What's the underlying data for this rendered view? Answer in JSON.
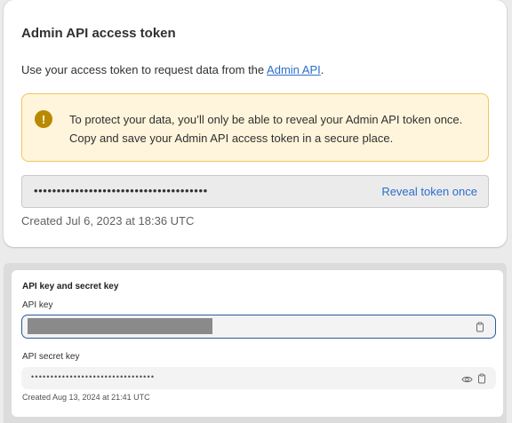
{
  "admin_token_card": {
    "title": "Admin API access token",
    "description_prefix": "Use your access token to request data from the ",
    "description_link": "Admin API",
    "description_suffix": ".",
    "warning": {
      "icon": "exclamation-icon",
      "message": "To protect your data, you’ll only be able to reveal your Admin API token once. Copy and save your Admin API access token in a secure place."
    },
    "token_mask": "••••••••••••••••••••••••••••••••••••••",
    "reveal_label": "Reveal token once",
    "created": "Created Jul 6, 2023 at 18:36 UTC"
  },
  "keys_card": {
    "title": "API key and secret key",
    "api_key_label": "API key",
    "api_secret_label": "API secret key",
    "secret_mask": "••••••••••••••••••••••••••••••••",
    "created": "Created Aug 13, 2024 at 21:41 UTC",
    "icons": [
      "clipboard-icon",
      "eye-icon"
    ]
  },
  "colors": {
    "link": "#2c6ecb",
    "warning_bg": "#fff5dc",
    "warning_border": "#f2c45c",
    "warning_icon": "#b98900",
    "focus_border": "#2c5a9a"
  }
}
